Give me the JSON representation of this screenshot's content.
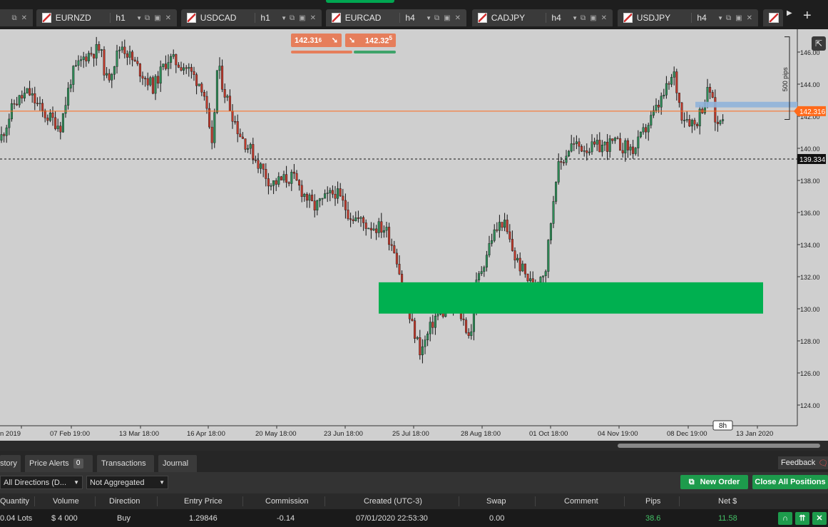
{
  "tabs": [
    {
      "symbol": "EURNZD",
      "timeframe": "h1"
    },
    {
      "symbol": "USDCAD",
      "timeframe": "h1"
    },
    {
      "symbol": "EURCAD",
      "timeframe": "h4"
    },
    {
      "symbol": "CADJPY",
      "timeframe": "h4"
    },
    {
      "symbol": "USDJPY",
      "timeframe": "h4"
    }
  ],
  "trade": {
    "sell_price": "142.31",
    "sell_sup": "6",
    "buy_price": "142.32",
    "buy_sup": "5",
    "sell_color": "#e67e5b",
    "buy_color": "#e67e5b",
    "sell_bar_color": "#e67e5b",
    "buy_bar_color": "#3fa36a"
  },
  "chart": {
    "current_price_label": "142.316",
    "dashed_level_label": "139.334",
    "range_label": "500 pips",
    "timeframe_badge": "8h",
    "y_labels": [
      "146.00",
      "144.00",
      "142.00",
      "140.00",
      "138.00",
      "136.00",
      "134.00",
      "132.00",
      "130.00",
      "128.00",
      "126.00",
      "124.00"
    ],
    "x_labels": [
      "n 2019",
      "07 Feb 19:00",
      "13 Mar 18:00",
      "16 Apr 18:00",
      "20 May 18:00",
      "23 Jun 18:00",
      "25 Jul 18:00",
      "28 Aug 18:00",
      "01 Oct 18:00",
      "04 Nov 19:00",
      "08 Dec 19:00",
      "13 Jan 2020"
    ],
    "price_line_color": "#ff6a1a",
    "zone_color": "#00b050",
    "hline_zone_color": "#8fb3d9",
    "bull_color": "#2e8b57",
    "bear_color": "#c0392b"
  },
  "bottom": {
    "tabs": [
      {
        "label": "story"
      },
      {
        "label": "Price Alerts",
        "badge": "0"
      },
      {
        "label": "Transactions"
      },
      {
        "label": "Journal"
      }
    ],
    "feedback_label": "Feedback",
    "filter_direction": "All Directions (D...",
    "filter_aggregation": "Not Aggregated",
    "new_order_label": "New Order",
    "close_all_label": "Close All Positions",
    "columns": [
      "Quantity",
      "Volume",
      "Direction",
      "Entry Price",
      "Commission",
      "Created (UTC-3)",
      "Swap",
      "Comment",
      "Pips",
      "Net $"
    ],
    "row": {
      "quantity": "0.04 Lots",
      "volume": "$ 4 000",
      "direction": "Buy",
      "entry_price": "1.29846",
      "commission": "-0.14",
      "created": "07/01/2020 22:53:30",
      "swap": "0.00",
      "comment": "",
      "pips": "38.6",
      "net": "11.58",
      "positive_color": "#44c267"
    }
  }
}
